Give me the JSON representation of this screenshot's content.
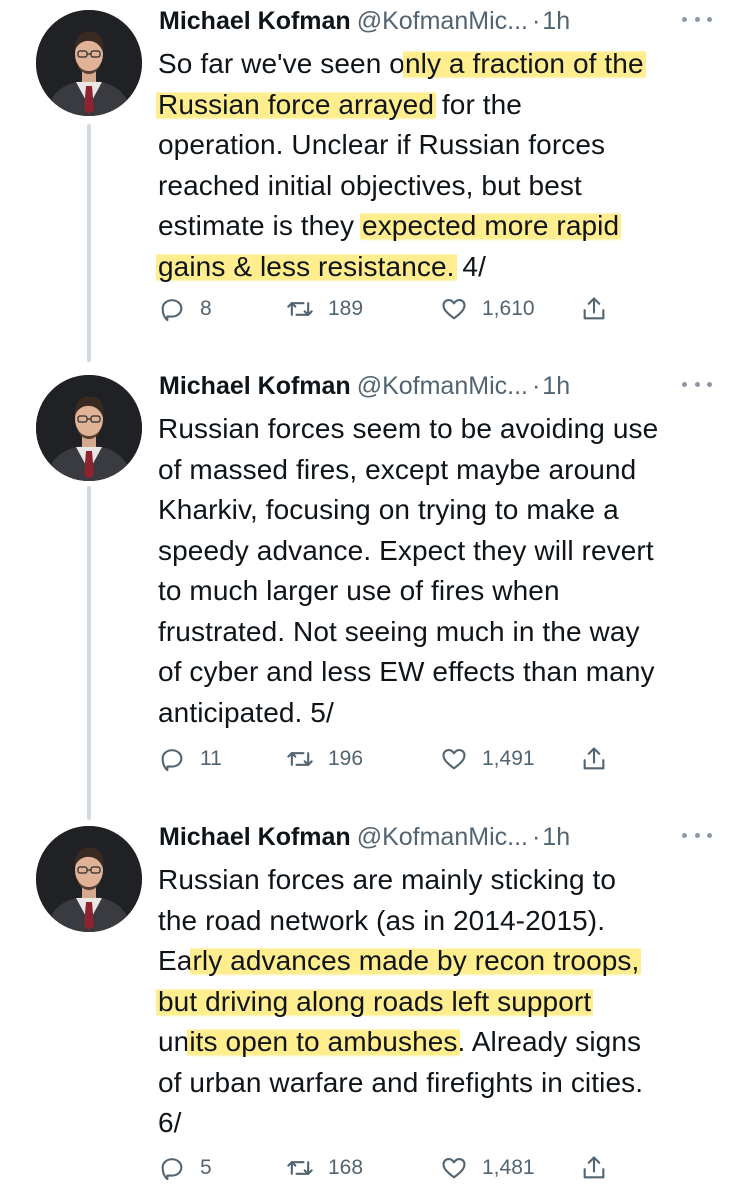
{
  "tweets": [
    {
      "author": "Michael Kofman",
      "handle": "@KofmanMic...",
      "dot": "·",
      "time": "1h",
      "lines": [
        {
          "parts": [
            {
              "t": "So far we've seen o",
              "hl": false
            },
            {
              "t": "nly a fraction of the",
              "hl": true
            }
          ]
        },
        {
          "parts": [
            {
              "t": "Russian force arrayed",
              "hl": true
            },
            {
              "t": " for the",
              "hl": false
            }
          ]
        },
        {
          "parts": [
            {
              "t": "operation. Unclear if Russian forces",
              "hl": false
            }
          ]
        },
        {
          "parts": [
            {
              "t": "reached initial objectives, but best",
              "hl": false
            }
          ]
        },
        {
          "parts": [
            {
              "t": "estimate is they ",
              "hl": false
            },
            {
              "t": "expected more rapid",
              "hl": true
            }
          ]
        },
        {
          "parts": [
            {
              "t": "gains & less resistance.",
              "hl": true
            },
            {
              "t": " 4/",
              "hl": false
            }
          ]
        }
      ],
      "replies": "8",
      "retweets": "189",
      "likes": "1,610"
    },
    {
      "author": "Michael Kofman",
      "handle": "@KofmanMic...",
      "dot": "·",
      "time": "1h",
      "lines": [
        {
          "parts": [
            {
              "t": "Russian forces seem to be avoiding use",
              "hl": false
            }
          ]
        },
        {
          "parts": [
            {
              "t": "of massed fires, except maybe around",
              "hl": false
            }
          ]
        },
        {
          "parts": [
            {
              "t": "Kharkiv, focusing on trying to make a",
              "hl": false
            }
          ]
        },
        {
          "parts": [
            {
              "t": "speedy advance. Expect they will revert",
              "hl": false
            }
          ]
        },
        {
          "parts": [
            {
              "t": "to much larger use of fires when",
              "hl": false
            }
          ]
        },
        {
          "parts": [
            {
              "t": "frustrated. Not seeing much in the way",
              "hl": false
            }
          ]
        },
        {
          "parts": [
            {
              "t": "of cyber and less EW effects than many",
              "hl": false
            }
          ]
        },
        {
          "parts": [
            {
              "t": "anticipated. 5/",
              "hl": false
            }
          ]
        }
      ],
      "replies": "11",
      "retweets": "196",
      "likes": "1,491"
    },
    {
      "author": "Michael Kofman",
      "handle": "@KofmanMic...",
      "dot": "·",
      "time": "1h",
      "lines": [
        {
          "parts": [
            {
              "t": "Russian forces are mainly sticking to",
              "hl": false
            }
          ]
        },
        {
          "parts": [
            {
              "t": "the road network (as in 2014-2015).",
              "hl": false
            }
          ]
        },
        {
          "parts": [
            {
              "t": "Ea",
              "hl": false
            },
            {
              "t": "rly advances made by recon troops,",
              "hl": true
            }
          ]
        },
        {
          "parts": [
            {
              "t": "but driving along roads left support",
              "hl": true
            }
          ]
        },
        {
          "parts": [
            {
              "t": "un",
              "hl": false
            },
            {
              "t": "its open to ambushes",
              "hl": true
            },
            {
              "t": ". Already signs",
              "hl": false
            }
          ]
        },
        {
          "parts": [
            {
              "t": "of urban warfare and firefights in cities.",
              "hl": false
            }
          ]
        },
        {
          "parts": [
            {
              "t": "6/",
              "hl": false
            }
          ]
        }
      ],
      "replies": "5",
      "retweets": "168",
      "likes": "1,481"
    }
  ],
  "colors": {
    "text": "#0f1419",
    "muted": "#536471",
    "thread_line": "#cfd9de",
    "highlight": "#ffe86e"
  },
  "icons": {
    "reply": "reply-icon",
    "retweet": "retweet-icon",
    "like": "heart-icon",
    "share": "share-icon",
    "more": "more-icon"
  }
}
